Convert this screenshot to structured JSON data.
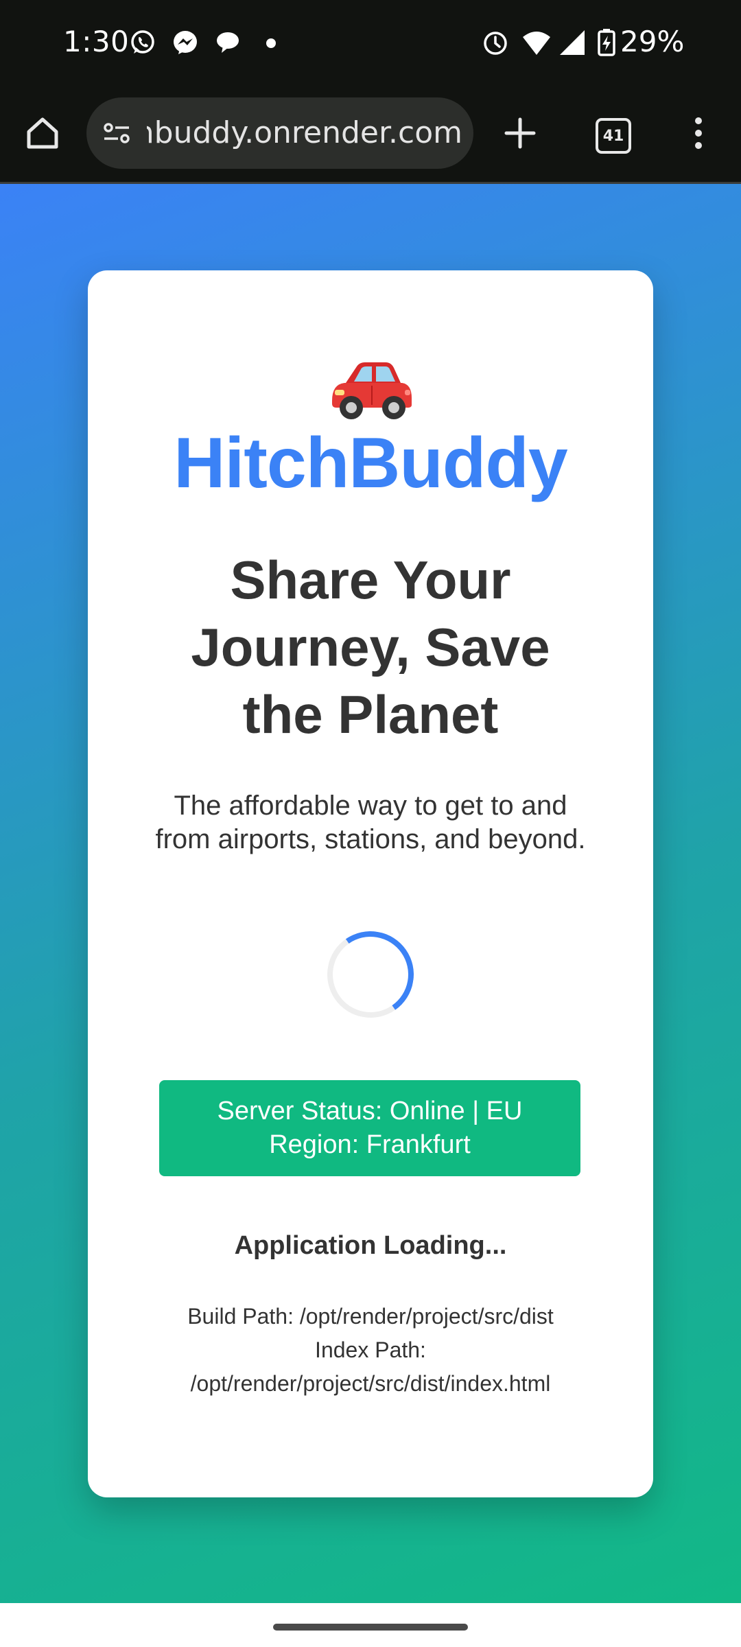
{
  "status_bar": {
    "time": "1:30",
    "battery": "29%",
    "notification_icons": [
      "whatsapp-icon",
      "messenger-icon",
      "chat-bubble-icon",
      "more-notifications-dot"
    ],
    "system_icons": [
      "alarm-icon",
      "wifi-icon",
      "signal-icon",
      "battery-charging-icon"
    ]
  },
  "browser": {
    "url": "hitchbuddy.onrender.com",
    "tab_count": "41",
    "icons": [
      "home-icon",
      "site-info-icon",
      "new-tab-icon",
      "tab-switcher-icon",
      "menu-icon"
    ]
  },
  "card": {
    "emoji": "car",
    "brand": "HitchBuddy",
    "headline_lines": [
      "Share Your",
      "Journey, Save",
      "the Planet"
    ],
    "subtitle": "The affordable way to get to and from airports, stations, and beyond.",
    "server_status": "Server Status: Online | EU Region: Frankfurt",
    "loading": "Application Loading...",
    "build_path": "Build Path: /opt/render/project/src/dist",
    "index_path_label": "Index Path:",
    "index_path": "/opt/render/project/src/dist/index.html"
  },
  "colors": {
    "brand": "#3b82f6",
    "status_green": "#10b981",
    "gradient_start": "#3b82f6",
    "gradient_end": "#12b886",
    "system_bar": "#111310"
  }
}
